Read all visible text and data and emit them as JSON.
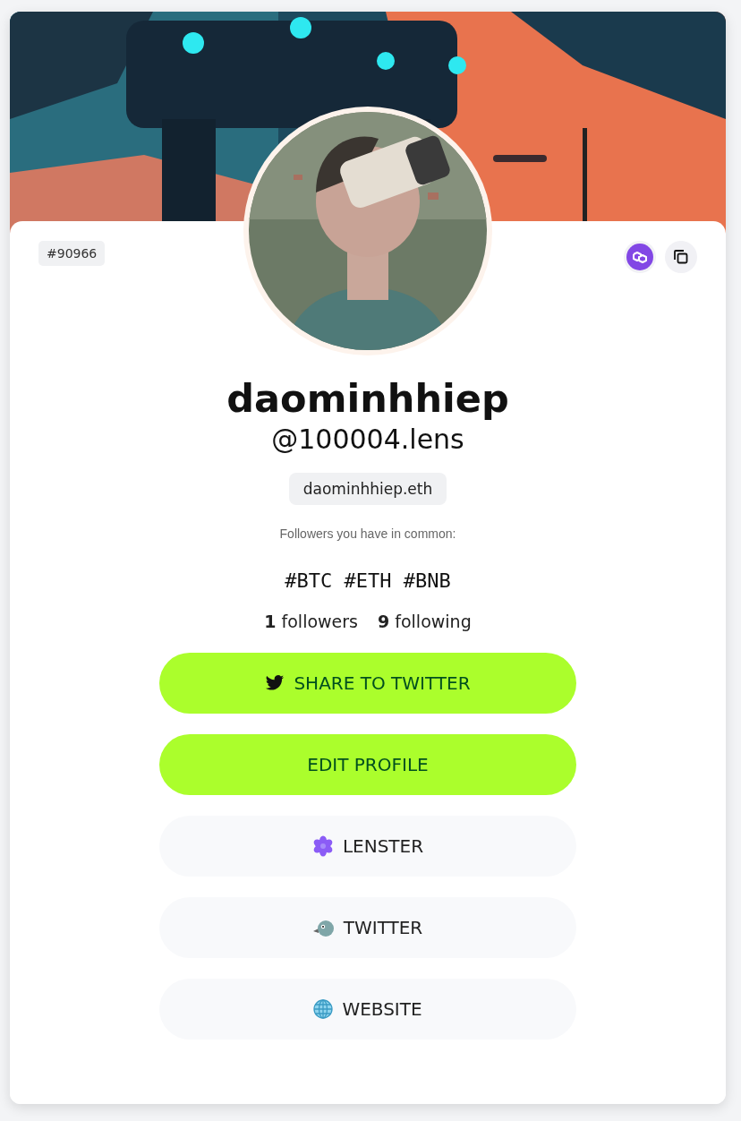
{
  "profile": {
    "id_badge": "#90966",
    "name": "daominhhiep",
    "handle": "@100004.lens",
    "ens": "daominhhiep.eth",
    "common_followers_label": "Followers you have in common:",
    "bio": "#BTC #ETH #BNB",
    "followers": "**1** followers",
    "following": "**9** following"
  },
  "buttons": [
    {
      "label": "SHARE TO TWITTER",
      "kind": "primary"
    },
    {
      "label": "EDIT PROFILE",
      "kind": "primary"
    },
    {
      "label": "LENSTER",
      "kind": "secondary"
    },
    {
      "label": "TWITTER",
      "kind": "secondary"
    },
    {
      "label": "WEBSITE",
      "kind": "secondary"
    }
  ]
}
